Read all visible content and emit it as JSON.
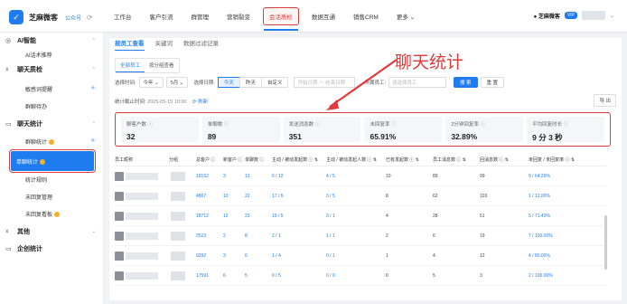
{
  "app": {
    "logo_char": "✓",
    "name": "芝麻微客",
    "sub": "公众号",
    "loading": "⟳"
  },
  "nav": {
    "items": [
      "工作台",
      "客户引流",
      "群管理",
      "营销裂变",
      "会话质检",
      "数据互通",
      "销售CRM",
      "更多"
    ],
    "more_suffix": "⌄",
    "active_index": 4
  },
  "topright": {
    "brand": "● 芝麻微客",
    "vip": "VIP"
  },
  "sidebar": {
    "groups": [
      {
        "label": "AI智能",
        "icon": "◎"
      },
      {
        "label": "聊天质检",
        "icon": "☓"
      },
      {
        "label": "聊天统计",
        "icon": "▭"
      },
      {
        "label": "其他",
        "icon": "☓"
      },
      {
        "label": "企创统计",
        "icon": "▭"
      }
    ],
    "items": [
      "AI话术推荐",
      "敏感词提醒",
      "群聊待办",
      "群聊统计",
      "单聊统计",
      "统计规则",
      "未回复管理",
      "未回复看板"
    ],
    "chevron": "⌃",
    "chevron_down": "⌄",
    "star": "★"
  },
  "content": {
    "tabs": [
      "按员工查看",
      "关键词",
      "数据过滤记录"
    ],
    "subtabs": [
      "全部员工",
      "按分组查看"
    ],
    "filters": {
      "time_label": "选择时间:",
      "year": "今年",
      "month": "5月",
      "date_label": "选择日期:",
      "segs": [
        "今天",
        "昨天",
        "自定义"
      ],
      "date_start": "开始日期",
      "date_sep": "～",
      "date_end": "结束日期",
      "emp_label": "所属员工:",
      "emp_placeholder": "请选择员工",
      "search": "搜 索",
      "reset": "重 置"
    },
    "stat_prefix": "统计截止时间:",
    "stat_time": "2025-05-15 10:00",
    "refresh": "⟳ 刷新",
    "export": "导 出",
    "annotation": "聊天统计"
  },
  "stats": [
    {
      "label": "聊客户数",
      "value": "32"
    },
    {
      "label": "单聊数",
      "value": "89"
    },
    {
      "label": "发送消息数",
      "value": "351"
    },
    {
      "label": "未回复率",
      "value": "65.91%"
    },
    {
      "label": "2分钟回复率",
      "value": "32.89%"
    },
    {
      "label": "平均回复时长",
      "value": "9 分 3 秒"
    }
  ],
  "table": {
    "headers": [
      "员工昵称",
      "分组",
      "总客户 ⓘ",
      "新客户 ⓘ",
      "单聊数 ⓘ",
      "主动 / 被动发起数 ⓘ ⇅",
      "主动 / 被动发起人数 ⓘ ⇅",
      "已有发起数 ⓘ ⇅",
      "员工消息数 ⓘ ⇅",
      "回消息数 ⓘ ⇅",
      "未回复 / 未回复率 ⓘ ⇅"
    ],
    "rows": [
      [
        "19152",
        "3",
        "13",
        "6 / 12",
        "4 / 5",
        "10",
        "89",
        "99",
        "9 / 64.29%"
      ],
      [
        "4867",
        "10",
        "22",
        "17 / 5",
        "3 / 5",
        "8",
        "62",
        "103",
        "1 / 12.00%"
      ],
      [
        "18712",
        "12",
        "23",
        "19 / 5",
        "3 / 1",
        "4",
        "28",
        "51",
        "5 / 71.43%"
      ],
      [
        "2523",
        "2",
        "8",
        "2 / 1",
        "1 / 1",
        "2",
        "6",
        "19",
        "7 / 100.00%"
      ],
      [
        "9292",
        "3",
        "6",
        "1 / 4",
        "0 / 1",
        "1",
        "4",
        "12",
        "4 / 80.00%"
      ],
      [
        "17591",
        "6",
        "5",
        "0 / 5",
        "0 / 0",
        "0",
        "5",
        "3",
        "2 / 100.00%"
      ]
    ]
  }
}
